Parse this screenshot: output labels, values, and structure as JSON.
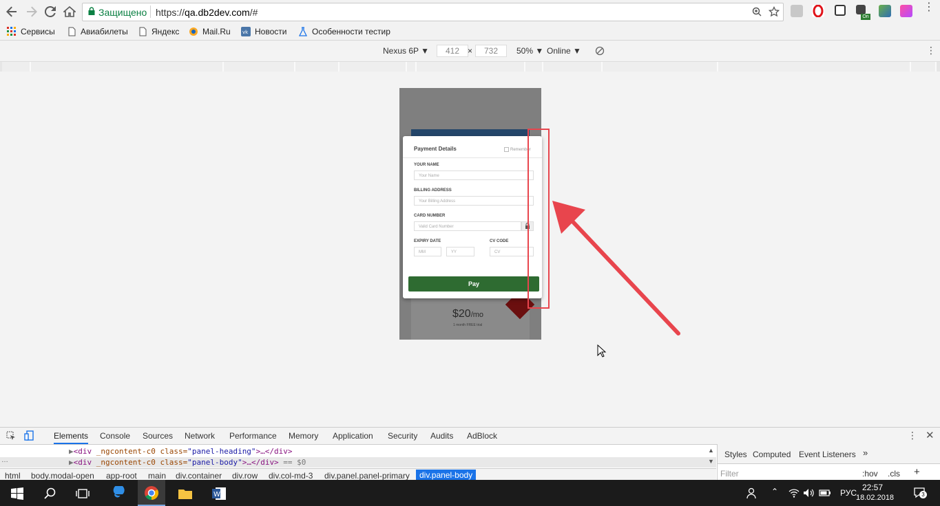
{
  "browser": {
    "secure_label": "Защищено",
    "url_prefix": "https://",
    "url_host": "qa.db2dev.com",
    "url_path": "/#",
    "bookmarks": [
      "Сервисы",
      "Авиабилеты",
      "Яндекс",
      "Mail.Ru",
      "Новости",
      "Особенности тестир"
    ]
  },
  "device_toolbar": {
    "device": "Nexus 6P",
    "width": "412",
    "times": "×",
    "height": "732",
    "zoom": "50%",
    "network": "Online"
  },
  "page": {
    "modal": {
      "title": "Payment Details",
      "remember": "Remember",
      "name_label": "YOUR NAME",
      "name_placeholder": "Your Name",
      "billing_label": "BILLING ADDRESS",
      "billing_placeholder": "Your Billing Address",
      "card_label": "CARD NUMBER",
      "card_placeholder": "Valid Card Number",
      "expiry_label": "EXPIRY DATE",
      "mm_placeholder": "MM",
      "yy_placeholder": "YY",
      "cv_label": "CV CODE",
      "cv_placeholder": "CV",
      "pay_label": "Pay"
    },
    "price": "$20",
    "price_unit": "/mo",
    "trial": "1 month FREE trial"
  },
  "devtools": {
    "tabs": [
      "Elements",
      "Console",
      "Sources",
      "Network",
      "Performance",
      "Memory",
      "Application",
      "Security",
      "Audits",
      "AdBlock"
    ],
    "code_line1": {
      "open": "<div ",
      "attr1": "_ngcontent-c0 ",
      "attr2": "class=",
      "val": "\"panel-heading\"",
      "close": ">…</div>"
    },
    "code_line2": {
      "open": "<div ",
      "attr1": "_ngcontent-c0 ",
      "attr2": "class=",
      "val": "\"panel-body\"",
      "close": ">…</div>",
      "suffix": " == $0"
    },
    "breadcrumbs": [
      "html",
      "body.modal-open",
      "app-root",
      "main",
      "div.container",
      "div.row",
      "div.col-md-3",
      "div.panel.panel-primary",
      "div.panel-body"
    ],
    "styles_tabs": [
      "Styles",
      "Computed",
      "Event Listeners"
    ],
    "filter_placeholder": "Filter",
    "hov": ":hov",
    "cls": ".cls"
  },
  "taskbar": {
    "lang": "РУС",
    "time": "22:57",
    "date": "18.02.2018",
    "notifications": "3"
  },
  "colors": {
    "secure": "#0b8043",
    "pay_button": "#2e6b31",
    "annotation": "#e8454d",
    "devtools_active": "#1a73e8"
  }
}
